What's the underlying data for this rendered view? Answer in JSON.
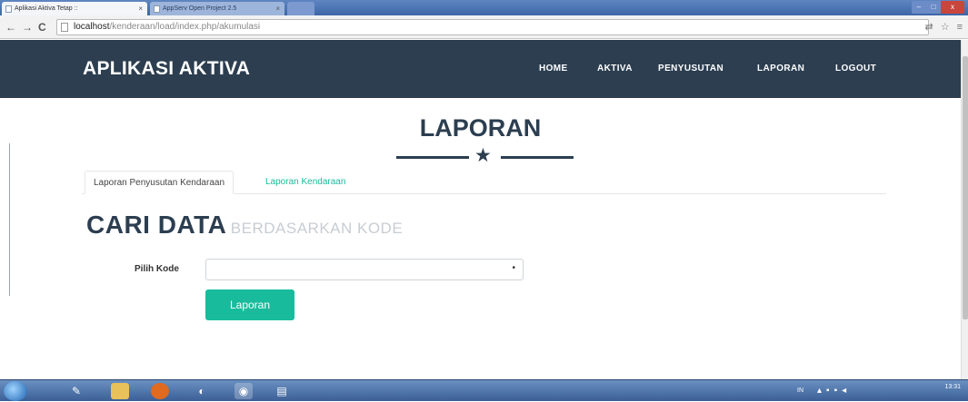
{
  "browser": {
    "tabs": [
      {
        "label": "Aplikasi Aktiva Tetap ::",
        "close": "×"
      },
      {
        "label": "AppServ Open Project 2.5",
        "close": "×"
      }
    ],
    "url_host": "localhost",
    "url_path": "/kenderaan/load/index.php/akumulasi",
    "nav_back": "←",
    "nav_forward": "→",
    "nav_reload": "C",
    "window_minimize": "–",
    "window_maximize": "□",
    "window_close": "x"
  },
  "navbar": {
    "brand": "APLIKASI AKTIVA",
    "items": [
      "HOME",
      "AKTIVA",
      "PENYUSUTAN",
      "LAPORAN",
      "LOGOUT"
    ]
  },
  "section": {
    "title": "LAPORAN",
    "divider_icon": "star-icon"
  },
  "tabs": [
    {
      "label": "Laporan Penyusutan Kendaraan",
      "active": true
    },
    {
      "label": "Laporan Kendaraan",
      "active": false
    }
  ],
  "search": {
    "heading": "CARI DATA",
    "subheading": "BERDASARKAN KODE",
    "label": "Pilih Kode",
    "select_value": "",
    "button_label": "Laporan"
  },
  "taskbar": {
    "language": "IN",
    "time": "13:31"
  },
  "colors": {
    "navbar": "#2c3e50",
    "accent": "#18bc9c",
    "heading": "#2c3e50"
  }
}
